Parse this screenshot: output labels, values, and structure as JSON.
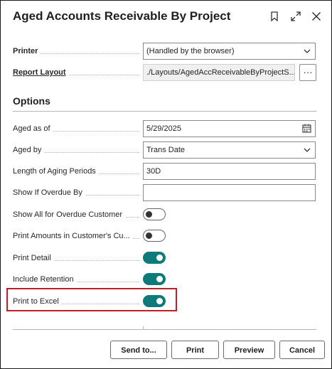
{
  "dialog": {
    "title": "Aged Accounts Receivable By Project",
    "icons": [
      "bookmark-icon",
      "expand-icon",
      "close-icon"
    ]
  },
  "printer": {
    "label": "Printer",
    "value": "(Handled by the browser)"
  },
  "report_layout": {
    "label": "Report Layout",
    "value": "./Layouts/AgedAccReceivableByProjectS...",
    "more_button": "···"
  },
  "options": {
    "heading": "Options",
    "aged_as_of": {
      "label": "Aged as of",
      "value": "5/29/2025"
    },
    "aged_by": {
      "label": "Aged by",
      "value": "Trans Date"
    },
    "length_of_aging_periods": {
      "label": "Length of Aging Periods",
      "value": "30D"
    },
    "show_if_overdue_by": {
      "label": "Show If Overdue By",
      "value": ""
    },
    "show_all_overdue_customer": {
      "label": "Show All for Overdue Customer",
      "checked": false
    },
    "print_amounts_customer_currency": {
      "label": "Print Amounts in Customer's Cu...",
      "checked": false
    },
    "print_detail": {
      "label": "Print Detail",
      "checked": true
    },
    "include_retention": {
      "label": "Include Retention",
      "checked": true
    },
    "print_to_excel": {
      "label": "Print to Excel",
      "checked": true
    }
  },
  "buttons": {
    "send_to": "Send to...",
    "print": "Print",
    "preview": "Preview",
    "cancel": "Cancel"
  },
  "colors": {
    "toggle_on": "#0f7a7a",
    "highlight": "#c11f28"
  }
}
